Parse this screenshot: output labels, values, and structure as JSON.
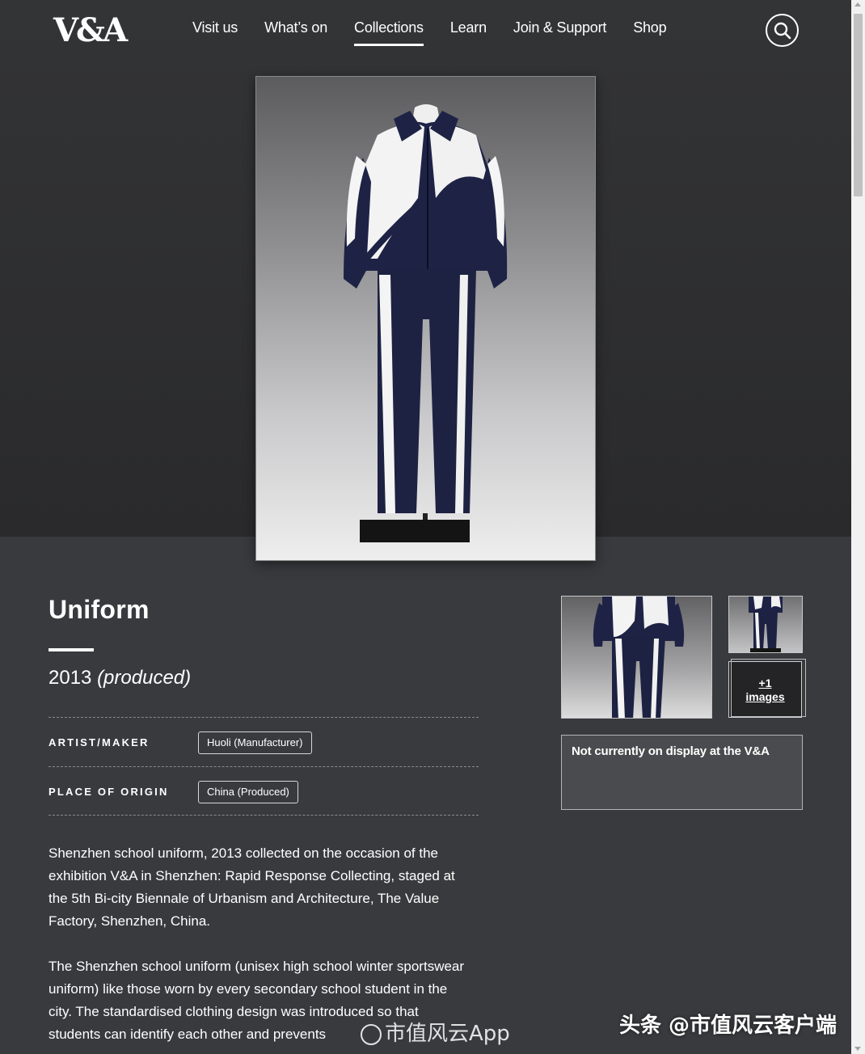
{
  "header": {
    "logo_text": "V&A",
    "nav": [
      {
        "label": "Visit us",
        "active": false
      },
      {
        "label": "What’s on",
        "active": false
      },
      {
        "label": "Collections",
        "active": true
      },
      {
        "label": "Learn",
        "active": false
      },
      {
        "label": "Join & Support",
        "active": false
      },
      {
        "label": "Shop",
        "active": false
      }
    ],
    "search_icon": "search-icon"
  },
  "object": {
    "title": "Uniform",
    "date_year": "2013",
    "date_qualifier": "(produced)",
    "details": [
      {
        "label": "ARTIST/MAKER",
        "value": "Huoli (Manufacturer)"
      },
      {
        "label": "PLACE OF ORIGIN",
        "value": "China (Produced)"
      }
    ],
    "description": [
      "Shenzhen school uniform, 2013 collected on the occasion of the exhibition V&A in Shenzhen: Rapid Response Collecting, staged at the 5th Bi-city Biennale of Urbanism and Architecture, The Value Factory, Shenzhen, China.",
      "The Shenzhen school uniform (unisex high school winter sportswear uniform) like those worn by every secondary school student in the city. The standardised clothing design was introduced so that students can identify each other and prevents"
    ]
  },
  "gallery": {
    "more_images_count": "+1",
    "more_images_label": "images",
    "display_status": "Not currently on display at the V&A"
  },
  "watermarks": {
    "weibo": "市值风云App",
    "toutiao": "头条 @市值风云客户端"
  },
  "colors": {
    "hero_background": "#2a2a2c",
    "page_background": "#393a3e",
    "text": "#ffffff"
  }
}
